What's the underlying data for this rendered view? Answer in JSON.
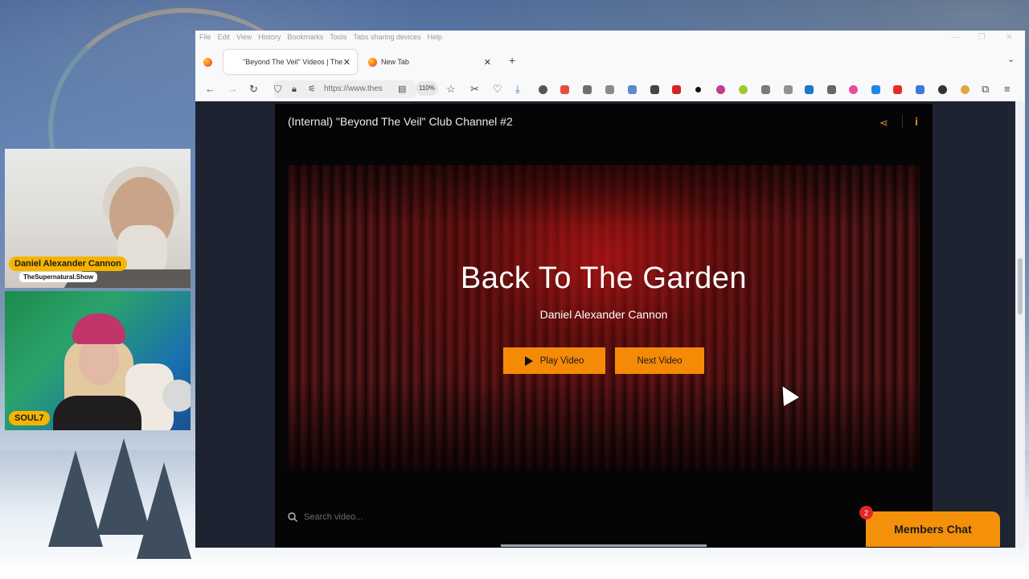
{
  "webcams": {
    "host": {
      "name": "Daniel Alexander Cannon",
      "subtitle": "TheSupernatural.Show"
    },
    "guest": {
      "name": "SOUL7"
    }
  },
  "browser": {
    "menu": [
      "File",
      "Edit",
      "View",
      "History",
      "Bookmarks",
      "Tools",
      "Tabs sharing devices",
      "Help"
    ],
    "tabs": [
      {
        "title": "\"Beyond The Veil\" Videos | The",
        "active": true
      },
      {
        "title": "New Tab",
        "active": false
      }
    ],
    "new_tab_symbol": "+",
    "url": "https://www.thes",
    "zoom": "110%"
  },
  "player": {
    "channel_title": "(Internal) \"Beyond The Veil\" Club Channel #2",
    "video_title": "Back To The Garden",
    "video_author": "Daniel Alexander Cannon",
    "play_label": "Play Video",
    "next_label": "Next Video",
    "search_placeholder": "Search video..."
  },
  "chat": {
    "label": "Members Chat",
    "unread_count": "2"
  },
  "colors": {
    "accent": "#f58a07",
    "badge": "#e12626",
    "player_bg": "#050505"
  }
}
